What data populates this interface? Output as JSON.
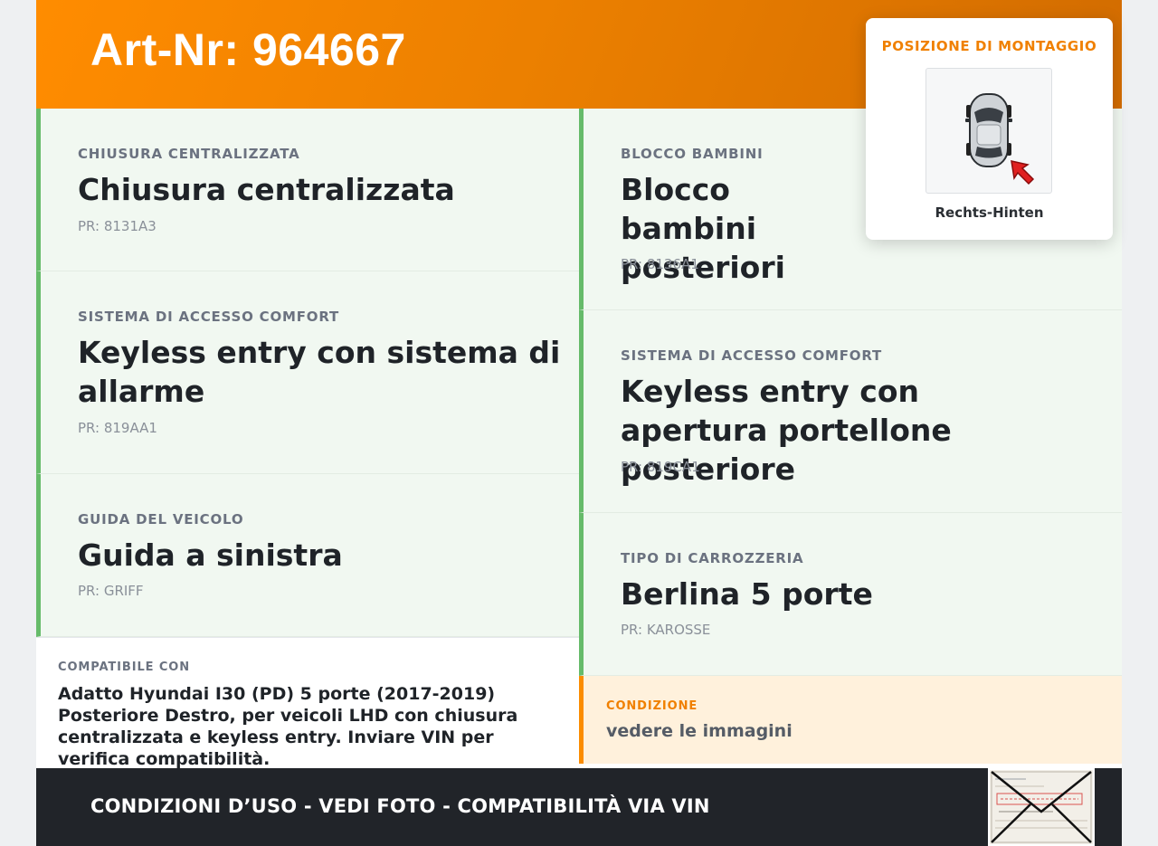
{
  "header": {
    "title": "Art-Nr: 964667"
  },
  "features_left": [
    {
      "category": "CHIUSURA CENTRALIZZATA",
      "value": "Chiusura centralizzata",
      "pr": "PR: 8131A3"
    },
    {
      "category": "SISTEMA DI ACCESSO COMFORT",
      "value": "Keyless entry con sistema di allarme",
      "pr": "PR: 819AA1"
    },
    {
      "category": "GUIDA DEL VEICOLO",
      "value": "Guida a sinistra",
      "pr": "PR: GRIFF"
    }
  ],
  "features_right": [
    {
      "category": "BLOCCO BAMBINI",
      "value": "Blocco bambini posteriori",
      "pr": "PR: 8136A1"
    },
    {
      "category": "SISTEMA DI ACCESSO COMFORT",
      "value": "Keyless entry con apertura portellone posteriore",
      "pr": "PR: 819CA1"
    },
    {
      "category": "TIPO DI CARROZZERIA",
      "value": "Berlina 5 porte",
      "pr": "PR: KAROSSE"
    }
  ],
  "compatibility": {
    "label": "COMPATIBILE CON",
    "text": "Adatto Hyundai I30 (PD) 5 porte (2017-2019) Posteriore Destro, per veicoli LHD con chiusura centralizzata e keyless entry. Inviare VIN per verifica compatibilità."
  },
  "condition": {
    "label": "CONDIZIONE",
    "text": "vedere le immagini"
  },
  "footer": {
    "text": "CONDIZIONI D’USO - VEDI FOTO - COMPATIBILITÀ VIA VIN"
  },
  "mounting_popup": {
    "title": "POSIZIONE DI MONTAGGIO",
    "position_label": "Rechts-Hinten",
    "image_icon": "car-top-view-icon",
    "marker_icon": "red-arrow-icon"
  },
  "colors": {
    "accent_orange": "#ff8c00",
    "feature_border_green": "#66bb6a",
    "condition_background": "#fff1dc",
    "footer_background": "#212429"
  }
}
